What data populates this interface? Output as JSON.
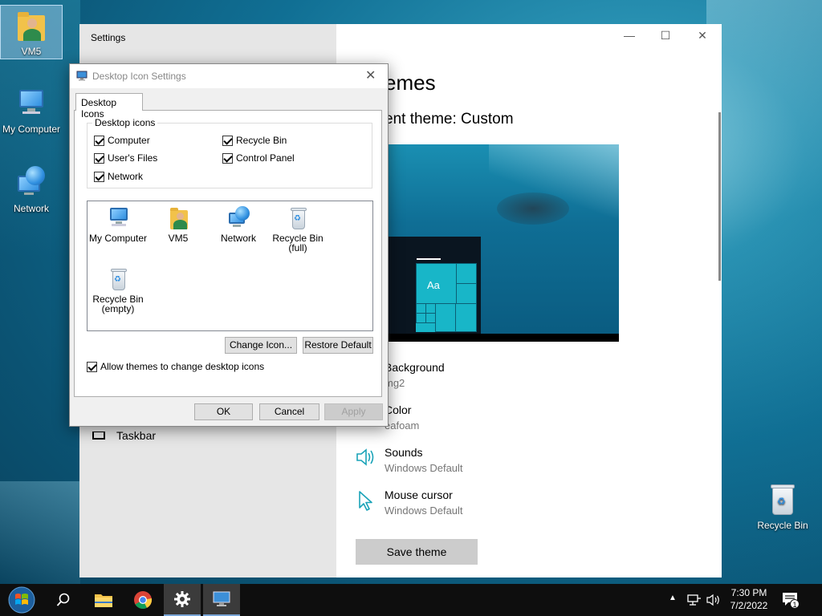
{
  "desktop": {
    "icons": [
      {
        "label": "VM5"
      },
      {
        "label": "My Computer"
      },
      {
        "label": "Network"
      },
      {
        "label": "Recycle Bin"
      }
    ]
  },
  "settings": {
    "window_title": "Settings",
    "heading": "emes",
    "current_theme_label": "ent theme: Custom",
    "preview_tile_text": "Aa",
    "sidebar_item_taskbar": "Taskbar",
    "background": {
      "label": "Background",
      "value": "mg2"
    },
    "color": {
      "label": "Color",
      "value": "eafoam"
    },
    "sounds": {
      "label": "Sounds",
      "value": "Windows Default"
    },
    "mouse_cursor": {
      "label": "Mouse cursor",
      "value": "Windows Default"
    },
    "save_theme_label": "Save theme",
    "minimize_glyph": "—",
    "maximize_glyph": "☐",
    "close_glyph": "✕"
  },
  "dialog": {
    "title": "Desktop Icon Settings",
    "close_glyph": "✕",
    "tab_label": "Desktop Icons",
    "group_label": "Desktop icons",
    "checkboxes": {
      "computer": "Computer",
      "users_files": "User's Files",
      "network": "Network",
      "recycle_bin": "Recycle Bin",
      "control_panel": "Control Panel"
    },
    "icon_list": [
      {
        "label": "My Computer"
      },
      {
        "label": "VM5"
      },
      {
        "label": "Network"
      },
      {
        "label": "Recycle Bin\n(full)"
      },
      {
        "label": "Recycle Bin\n(empty)"
      }
    ],
    "change_icon_label": "Change Icon...",
    "restore_default_label": "Restore Default",
    "allow_themes_label": "Allow themes to change desktop icons",
    "ok_label": "OK",
    "cancel_label": "Cancel",
    "apply_label": "Apply"
  },
  "taskbar": {
    "time": "7:30 PM",
    "date": "7/2/2022",
    "notification_count": "1"
  }
}
